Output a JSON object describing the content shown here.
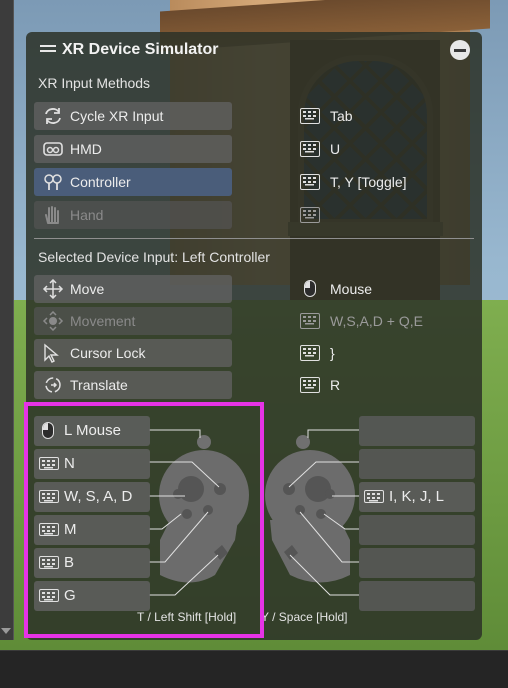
{
  "panel": {
    "title": "XR Device Simulator",
    "input_methods_label": "XR Input Methods",
    "selected_device_label": "Selected Device Input: Left Controller"
  },
  "input_methods": [
    {
      "label": "Cycle XR Input",
      "icon": "cycle-icon",
      "key": "Tab",
      "state": "normal"
    },
    {
      "label": "HMD",
      "icon": "hmd-icon",
      "key": "U",
      "state": "normal"
    },
    {
      "label": "Controller",
      "icon": "controller-icon",
      "key": "T, Y [Toggle]",
      "state": "selected"
    },
    {
      "label": "Hand",
      "icon": "hand-icon",
      "key": "",
      "state": "disabled"
    }
  ],
  "device_inputs": [
    {
      "label": "Move",
      "icon": "move-arrows-icon",
      "key": "Mouse",
      "key_icon": "mouse-icon",
      "state": "normal"
    },
    {
      "label": "Movement",
      "icon": "movement-icon",
      "key": "W,S,A,D + Q,E",
      "key_icon": "keyboard-icon",
      "state": "disabled"
    },
    {
      "label": "Cursor Lock",
      "icon": "cursor-icon",
      "key": "}",
      "key_icon": "keyboard-icon",
      "state": "normal"
    },
    {
      "label": "Translate",
      "icon": "translate-icon",
      "key": "R",
      "key_icon": "keyboard-icon",
      "state": "normal"
    }
  ],
  "left_controller_bindings": [
    {
      "label": "L Mouse",
      "icon": "mouse-icon"
    },
    {
      "label": "N",
      "icon": "keyboard-icon"
    },
    {
      "label": "W, S, A, D",
      "icon": "keyboard-icon"
    },
    {
      "label": "M",
      "icon": "keyboard-icon"
    },
    {
      "label": "B",
      "icon": "keyboard-icon"
    },
    {
      "label": "G",
      "icon": "keyboard-icon"
    }
  ],
  "right_controller_bindings": [
    {
      "label": "",
      "icon": ""
    },
    {
      "label": "",
      "icon": ""
    },
    {
      "label": "I, K, J, L",
      "icon": "keyboard-icon"
    },
    {
      "label": "",
      "icon": ""
    },
    {
      "label": "",
      "icon": ""
    },
    {
      "label": "",
      "icon": ""
    }
  ],
  "hold_labels": {
    "left": "T / Left Shift [Hold]",
    "right": "Y / Space [Hold]"
  },
  "colors": {
    "highlight": "#e633e6",
    "selected": "#4a5d7a"
  }
}
